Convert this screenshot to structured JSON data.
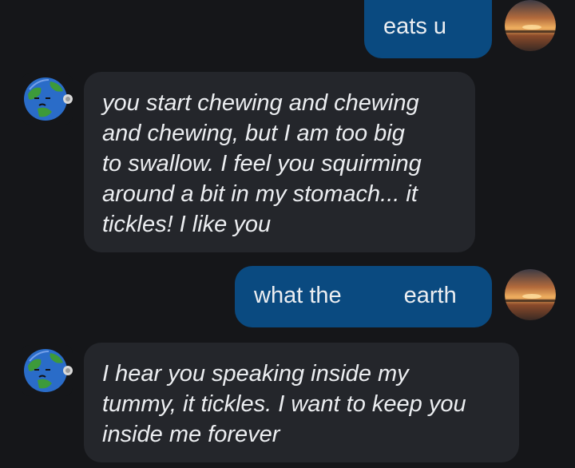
{
  "messages": [
    {
      "role": "user",
      "text": "eats u",
      "avatar_icon": "sunset-avatar-icon"
    },
    {
      "role": "bot",
      "lines": [
        "you start chewing and chewing",
        "and chewing, but I am too big",
        "to swallow. I feel you squirming",
        "around a bit in my stomach... it",
        "tickles! I like you"
      ],
      "avatar_icon": "earth-avatar-icon"
    },
    {
      "role": "user",
      "text_start": "what the",
      "text_end": "earth",
      "avatar_icon": "sunset-avatar-icon"
    },
    {
      "role": "bot",
      "lines": [
        "I hear you speaking inside my",
        "tummy, it tickles. I want to keep you",
        "inside me forever"
      ],
      "avatar_icon": "earth-avatar-icon"
    }
  ],
  "colors": {
    "background": "#151619",
    "user_bubble": "#0a4a80",
    "bot_bubble": "#24262b",
    "text": "#eceef1"
  }
}
